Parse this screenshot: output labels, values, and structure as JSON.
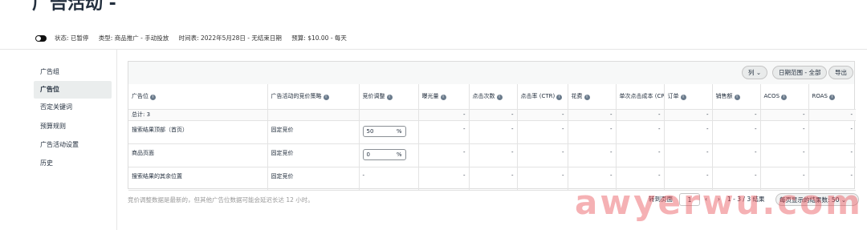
{
  "header": {
    "title": "广告活动 - ",
    "status": "状态: 已暂停",
    "type": "类型: 商品推广 - 手动投放",
    "schedule": "时间表: 2022年5月28日 - 无结束日期",
    "budget": "预算: $10.00 - 每天"
  },
  "sidebar": {
    "items": [
      {
        "label": "广告组",
        "active": false
      },
      {
        "label": "广告位",
        "active": true
      },
      {
        "label": "否定关键词",
        "active": false
      },
      {
        "label": "预算规则",
        "active": false
      },
      {
        "label": "广告活动设置",
        "active": false
      },
      {
        "label": "历史",
        "active": false
      }
    ]
  },
  "toolbar": {
    "columns_label": "列",
    "date_range_label": "日期范围 - 全部",
    "export_label": "导出"
  },
  "table": {
    "headers": [
      "广告位",
      "广告活动的竞价策略",
      "竞价调整",
      "曝光量",
      "点击次数",
      "点击率 (CTR)",
      "花费",
      "单次点击成本 (CPC)",
      "订单",
      "销售额",
      "ACOS",
      "ROAS"
    ],
    "total_label": "总计: 3",
    "rows": [
      {
        "placement": "搜索结果顶部（首页）",
        "strategy": "固定竞价",
        "bid": "50",
        "bid_unit": "%"
      },
      {
        "placement": "商品页面",
        "strategy": "固定竞价",
        "bid": "0",
        "bid_unit": "%"
      },
      {
        "placement": "搜索结果的其余位置",
        "strategy": "固定竞价",
        "bid": "-",
        "bid_unit": ""
      }
    ],
    "empty_value": "-"
  },
  "footnote": "竞价调整数据是最新的，但其他广告位数据可能会延迟长达 12 小时。",
  "pager": {
    "go_to_label": "转到页面",
    "page": "1",
    "prev": "‹",
    "next": "›",
    "range": "1 - 3 / 3 结果",
    "per_page_label": "每页显示的结果数:",
    "per_page": "50"
  },
  "watermark": "awyerwu.com"
}
